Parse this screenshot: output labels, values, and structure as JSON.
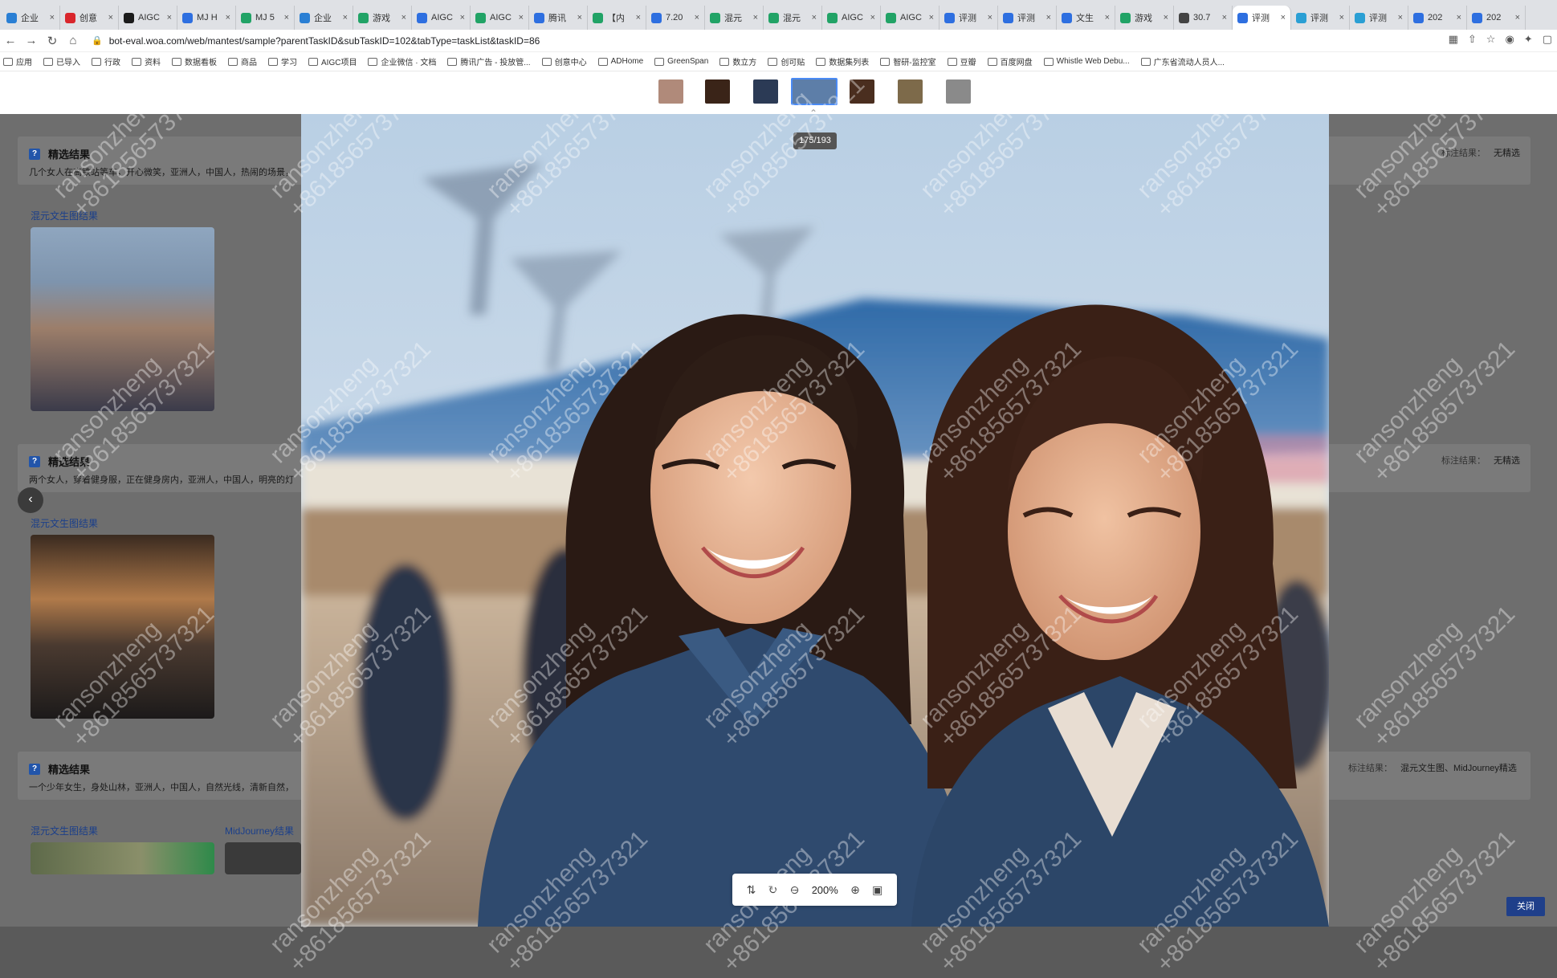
{
  "browser": {
    "tabs": [
      {
        "label": "企业",
        "color": "#2a7fd4"
      },
      {
        "label": "创意",
        "color": "#d9262c"
      },
      {
        "label": "AIGC",
        "color": "#1b1b1b"
      },
      {
        "label": "MJ H",
        "color": "#2e6fe0"
      },
      {
        "label": "MJ 5",
        "color": "#21a366"
      },
      {
        "label": "企业",
        "color": "#2a7fd4"
      },
      {
        "label": "游戏",
        "color": "#21a366"
      },
      {
        "label": "AIGC",
        "color": "#2e6fe0"
      },
      {
        "label": "AIGC",
        "color": "#21a366"
      },
      {
        "label": "腾讯",
        "color": "#2e6fe0"
      },
      {
        "label": "【内",
        "color": "#21a366"
      },
      {
        "label": "7.20",
        "color": "#2e6fe0"
      },
      {
        "label": "混元",
        "color": "#21a366"
      },
      {
        "label": "混元",
        "color": "#21a366"
      },
      {
        "label": "AIGC",
        "color": "#21a366"
      },
      {
        "label": "AIGC",
        "color": "#21a366"
      },
      {
        "label": "评测",
        "color": "#2e6fe0"
      },
      {
        "label": "评测",
        "color": "#2e6fe0"
      },
      {
        "label": "文生",
        "color": "#2e6fe0"
      },
      {
        "label": "游戏",
        "color": "#21a366"
      },
      {
        "label": "30.7",
        "color": "#444444"
      },
      {
        "label": "评测",
        "color": "#2e6fe0"
      },
      {
        "label": "评测",
        "color": "#2a9fd4"
      },
      {
        "label": "评测",
        "color": "#2a9fd4"
      },
      {
        "label": "202",
        "color": "#2e6fe0"
      },
      {
        "label": "202",
        "color": "#2e6fe0"
      }
    ],
    "active_tab_index": 21,
    "url": "bot-eval.woa.com/web/mantest/sample?parentTaskID&subTaskID=102&tabType=taskList&taskID=86",
    "bookmarks": [
      "应用",
      "已导入",
      "行政",
      "资料",
      "数据看板",
      "商品",
      "学习",
      "AIGC项目",
      "企业微信 · 文档",
      "腾讯广告 - 投放管...",
      "创意中心",
      "ADHome",
      "GreenSpan",
      "数立方",
      "创可贴",
      "数据集列表",
      "智研-监控室",
      "豆瓣",
      "百度网盘",
      "Whistle Web Debu...",
      "广东省流动人员人..."
    ]
  },
  "viewer": {
    "counter": "175/193",
    "zoom": "200%",
    "close_label": "关闭",
    "thumbnails": [
      {
        "color": "#b08a7a"
      },
      {
        "color": "#3a2418"
      },
      {
        "color": "#2b3a55"
      },
      {
        "color": "#5d7ea8"
      },
      {
        "color": "#4a2e1f"
      },
      {
        "color": "#7d6a4a"
      },
      {
        "color": "#8a8a8a"
      }
    ],
    "selected_thumbnail": 3
  },
  "cards": [
    {
      "title": "精选结果",
      "desc": "几个女人在高铁站等车，开心微笑，亚洲人，中国人，热闹的场景，",
      "result_label": "混元文生图结果",
      "anno_key": "标注结果：",
      "anno_val": "无精选"
    },
    {
      "title": "精选结果",
      "desc": "两个女人，穿着健身服，正在健身房内，亚洲人，中国人，明亮的灯",
      "result_label": "混元文生图结果",
      "anno_key": "标注结果：",
      "anno_val": "无精选"
    },
    {
      "title": "精选结果",
      "desc": "一个少年女生，身处山林，亚洲人，中国人，自然光线，清新自然，",
      "result_label": "混元文生图结果",
      "result_label_2": "MidJourney结果",
      "anno_key": "标注结果：",
      "anno_val": "混元文生图、MidJourney精选"
    }
  ],
  "watermark": {
    "line1": "ransonzheng",
    "line2": "+8618565737321"
  }
}
